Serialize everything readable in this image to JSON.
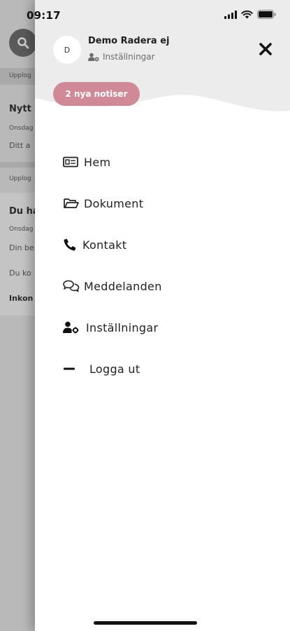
{
  "status_bar": {
    "time": "09:17"
  },
  "background": {
    "rows": [
      "Upplog",
      "Nytt",
      "Onsdag",
      "Ditt a",
      "Upplog",
      "Du ha",
      "Onsdag",
      "Din be",
      "Du ko",
      "Inkon"
    ]
  },
  "drawer": {
    "avatar_initial": "D",
    "user_name": "Demo Radera ej",
    "settings_link": "Inställningar",
    "notice_pill": "2 nya notiser",
    "menu": [
      {
        "label": "Hem",
        "icon": "id-card-icon"
      },
      {
        "label": "Dokument",
        "icon": "folder-open-icon"
      },
      {
        "label": "Kontakt",
        "icon": "phone-icon"
      },
      {
        "label": "Meddelanden",
        "icon": "chat-bubbles-icon"
      },
      {
        "label": "Inställningar",
        "icon": "user-cog-icon"
      },
      {
        "label": "Logga ut",
        "icon": "minus-icon"
      }
    ]
  },
  "colors": {
    "header_bg": "#ececec",
    "pill_bg": "#d08a97",
    "overlay": "#b9b9b9"
  }
}
